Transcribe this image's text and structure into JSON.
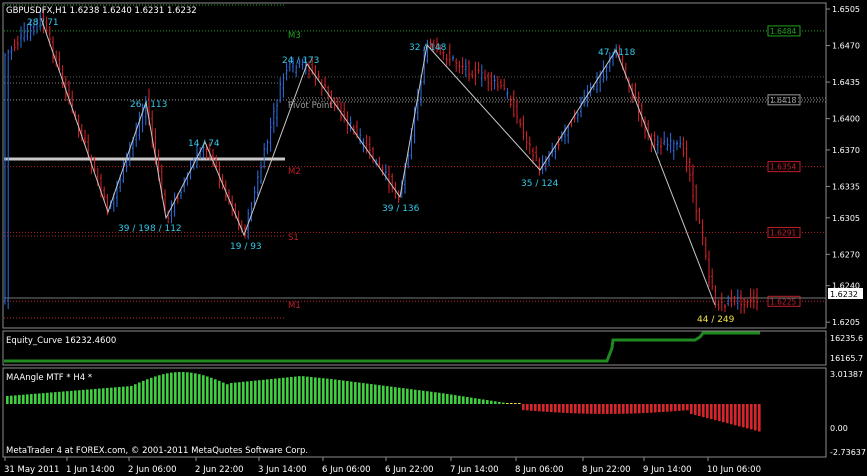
{
  "main": {
    "header": "GBPUSDFX,H1  1.6238 1.6240 1.6231 1.6232",
    "current_price": "1.6232",
    "price_scale": [
      "1.6505",
      "1.6470",
      "1.6435",
      "1.6400",
      "1.6370",
      "1.6335",
      "1.6305",
      "1.6270",
      "1.6240",
      "1.6205"
    ],
    "pivot_levels": [
      {
        "name": "M3",
        "price": "1.6484",
        "color": "#1fa31f"
      },
      {
        "name": "Pivot Point",
        "price": "1.6418",
        "color": "#9a9a9a"
      },
      {
        "name": "M2",
        "price": "1.6354",
        "color": "#c0202a"
      },
      {
        "name": "S1",
        "price": "1.6291",
        "color": "#c0202a"
      },
      {
        "name": "M1",
        "price": "1.6225",
        "color": "#c0202a"
      }
    ],
    "extra_price_tag": "1.6418",
    "zigzag_labels": [
      {
        "text": "28 / 71",
        "color": "#35c8e8"
      },
      {
        "text": "26 / 113",
        "color": "#35c8e8"
      },
      {
        "text": "39 / 19",
        "color": "#35c8e8"
      },
      {
        "text": "8 / 112",
        "color": "#35c8e8"
      },
      {
        "text": "14 / 74",
        "color": "#35c8e8"
      },
      {
        "text": "19 / 93",
        "color": "#35c8e8"
      },
      {
        "text": "24 / 173",
        "color": "#35c8e8"
      },
      {
        "text": "39 / 136",
        "color": "#35c8e8"
      },
      {
        "text": "32 / 148",
        "color": "#35c8e8"
      },
      {
        "text": "35 / 124",
        "color": "#35c8e8"
      },
      {
        "text": "47 / 118",
        "color": "#35c8e8"
      },
      {
        "text": "44 / 249",
        "color": "#f2e04a"
      }
    ],
    "bull_color": "#2f6fe0",
    "bear_color": "#d8242a"
  },
  "equity": {
    "title": "Equity_Curve 16232.4600",
    "scale_top": "16235.6",
    "scale_bottom": "16165.7",
    "line_color": "#1f8a1f"
  },
  "maangle": {
    "title": "MAAngle MTF * H4 *",
    "scale": [
      "3.01387",
      "0.00",
      "-2.73637"
    ],
    "positive_color": "#3fd03f",
    "negative_color": "#d8242a",
    "neutral_color": "#e8e040"
  },
  "footer": "MetaTrader 4 at FOREX.com, © 2001-2011 MetaQuotes Software Corp.",
  "time_axis": [
    "31 May 2011",
    "1 Jun 14:00",
    "2 Jun 06:00",
    "2 Jun 22:00",
    "3 Jun 14:00",
    "6 Jun 06:00",
    "6 Jun 22:00",
    "7 Jun 14:00",
    "8 Jun 06:00",
    "8 Jun 22:00",
    "9 Jun 14:00",
    "10 Jun 06:00"
  ]
}
